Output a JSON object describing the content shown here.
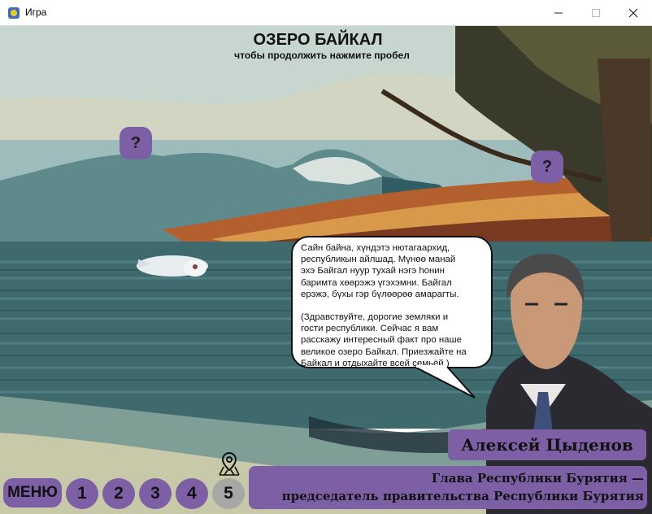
{
  "window": {
    "title": "Игра",
    "minimize_icon": "minimize-icon",
    "maximize_icon": "maximize-icon",
    "close_icon": "close-icon"
  },
  "scene": {
    "title": "ОЗЕРО БАЙКАЛ",
    "subtitle": "чтобы продолжить нажмите пробел"
  },
  "hotspots": [
    {
      "label": "?"
    },
    {
      "label": "?"
    }
  ],
  "dialog": {
    "buryat_text": "Сайн байна, хүндэтэ нютагаархид,\nреспубликын айлшад. Мүнөө манай\nэхэ Байгал нуур тухай нэгэ һонин\nбаримта хөөрэжэ үгэхэмни. Байгал\nерэжэ, бүхы гэр бүлөөрөө амарагты.",
    "russian_text": "(Здравствуйте, дорогие земляки и\nгости республики. Сейчас я вам\nрасскажу интересный факт про наше\nвеликое озеро Байкал. Приезжайте на\nБайкал и отдыхайте всей семьёй.)"
  },
  "speaker": {
    "name": "Алексей Цыденов",
    "role_line1": "Глава Республики Бурятия —",
    "role_line2": "председатель правительства Республики Бурятия"
  },
  "bottom_nav": {
    "menu_label": "МЕНЮ",
    "levels": [
      "1",
      "2",
      "3",
      "4",
      "5"
    ],
    "active_level": "5",
    "map_icon": "map-pin-icon"
  },
  "colors": {
    "accent": "#7d5fa6",
    "active_level": "#a7a7a7"
  }
}
